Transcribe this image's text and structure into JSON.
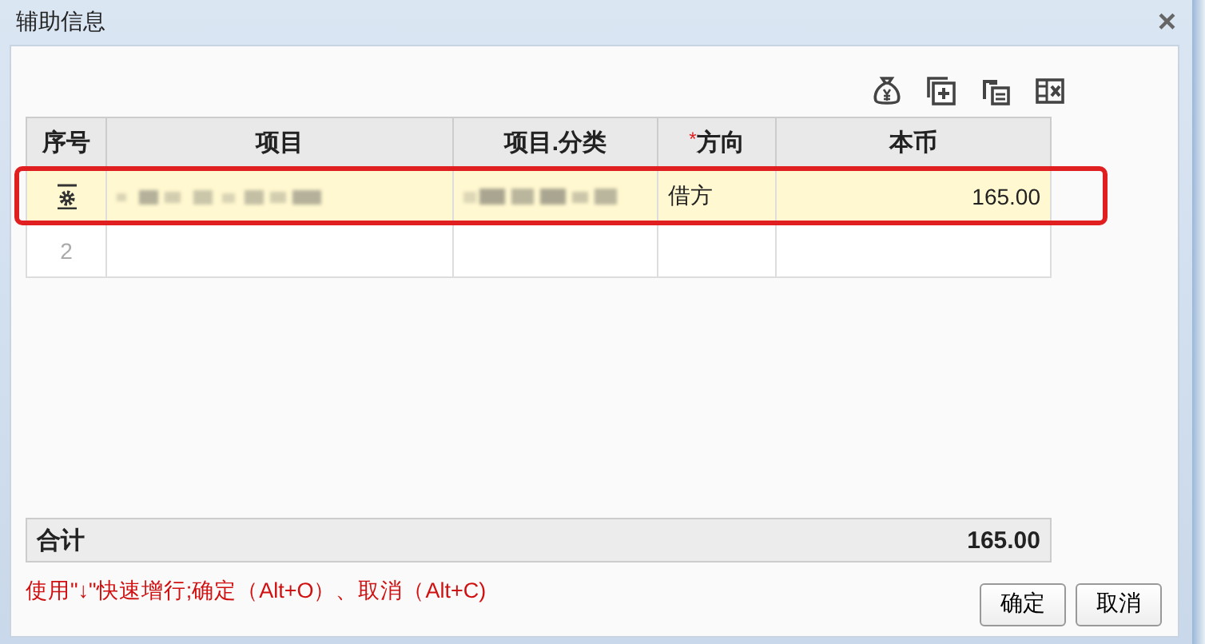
{
  "window": {
    "title": "辅助信息",
    "close": "×"
  },
  "table": {
    "columns": [
      {
        "label": "序号"
      },
      {
        "label": "项目"
      },
      {
        "label": "项目.分类"
      },
      {
        "label": "方向",
        "required_marker": "*"
      },
      {
        "label": "本币"
      }
    ],
    "rows": [
      {
        "selected": true,
        "highlighted": true,
        "item_redacted": true,
        "category_redacted": true,
        "direction": "借方",
        "amount": "165.00"
      },
      {
        "selected": false,
        "highlighted": false,
        "number": "2",
        "item_redacted": false,
        "category_redacted": false
      }
    ]
  },
  "total": {
    "label": "合计",
    "amount": "165.00"
  },
  "hint": "使用\"↓\"快速增行;确定（Alt+O）、取消（Alt+C)",
  "buttons": [
    "确定",
    "取消"
  ]
}
